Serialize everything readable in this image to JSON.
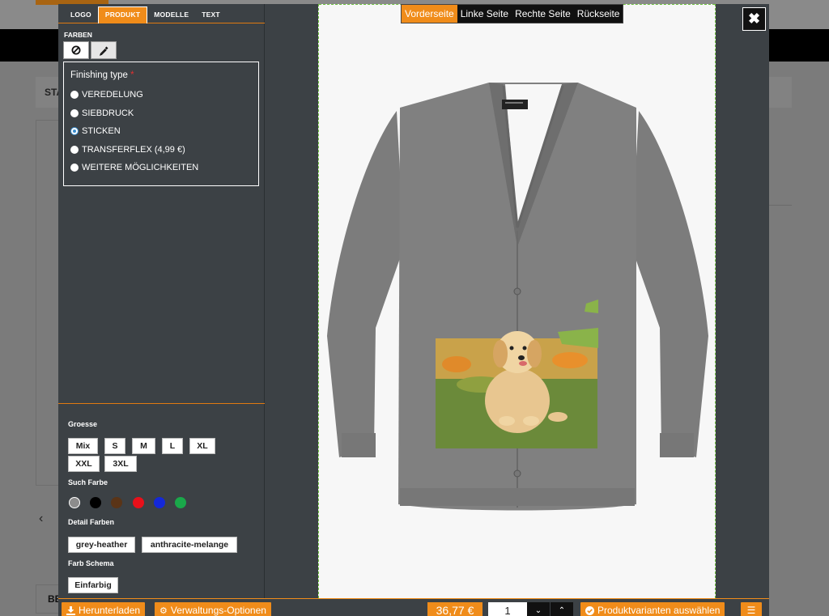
{
  "background": {
    "breadcrumb_text": "STA",
    "bottom_text": "BE"
  },
  "tabs": [
    {
      "label": "LOGO"
    },
    {
      "label": "PRODUKT"
    },
    {
      "label": "MODELLE"
    },
    {
      "label": "TEXT"
    }
  ],
  "farben_label": "FARBEN",
  "finishing": {
    "title": "Finishing type",
    "required_mark": "*",
    "options": [
      {
        "label": "VEREDELUNG",
        "selected": false
      },
      {
        "label": "SIEBDRUCK",
        "selected": false
      },
      {
        "label": "STICKEN",
        "selected": true
      },
      {
        "label": "TRANSFERFLEX (4,99 €)",
        "selected": false
      },
      {
        "label": "WEITERE MÖGLICHKEITEN",
        "selected": false
      }
    ]
  },
  "groesse": {
    "label": "Groesse",
    "sizes": [
      "Mix",
      "S",
      "M",
      "L",
      "XL",
      "XXL",
      "3XL"
    ]
  },
  "such_farbe": {
    "label": "Such Farbe",
    "colors": [
      "#8c8c8c",
      "#000000",
      "#5a3417",
      "#e8101a",
      "#1428d8",
      "#1aa84a"
    ]
  },
  "detail_farben": {
    "label": "Detail Farben",
    "items": [
      "grey-heather",
      "anthracite-melange"
    ]
  },
  "farb_schema": {
    "label": "Farb Schema",
    "items": [
      "Einfarbig"
    ]
  },
  "view_tabs": [
    {
      "label": "Vorderseite"
    },
    {
      "label": "Linke Seite"
    },
    {
      "label": "Rechte Seite"
    },
    {
      "label": "Rückseite"
    }
  ],
  "bottom": {
    "download_label": "Herunterladen",
    "admin_label": "Verwaltungs-Optionen",
    "price": "36,77 €",
    "quantity": "1",
    "variants_label": "Produktvarianten auswählen"
  },
  "accent_color": "#f08c1a"
}
